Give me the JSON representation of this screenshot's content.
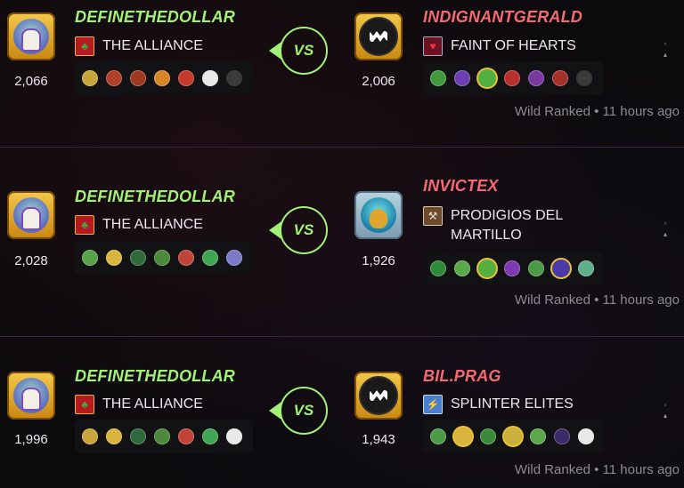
{
  "battles": [
    {
      "player": {
        "name": "DEFINETHEDOLLAR",
        "rating": "2,066",
        "guild": "THE ALLIANCE",
        "avatar": "wizard-avatar-icon"
      },
      "opponent": {
        "name": "INDIGNANTGERALD",
        "rating": "2,006",
        "guild": "FAINT OF HEARTS",
        "avatar": "monster-avatar-icon"
      },
      "vs_label": "VS",
      "format": "Wild Ranked",
      "time": "11 hours ago",
      "player_team": [
        "#c9a43a",
        "#b0402b",
        "#9c3a1f",
        "#d88428",
        "#c6382a",
        "#e8e8ea",
        "#3a3a3a"
      ],
      "opponent_team": [
        "#3f9a3c",
        "#6b3fb0",
        "#4fb040",
        "#b8302c",
        "#7a3aa0",
        "#a5302a",
        "#3a3a3a"
      ]
    },
    {
      "player": {
        "name": "DEFINETHEDOLLAR",
        "rating": "2,028",
        "guild": "THE ALLIANCE",
        "avatar": "wizard-avatar-icon"
      },
      "opponent": {
        "name": "INVICTEX",
        "rating": "1,926",
        "guild": "PRODIGIOS DEL MARTILLO",
        "avatar": "dragon-avatar-icon"
      },
      "vs_label": "VS",
      "format": "Wild Ranked",
      "time": "11 hours ago",
      "player_team": [
        "#58a24a",
        "#d9b43e",
        "#2e6a3a",
        "#4a8a3a",
        "#c24438",
        "#3fa552",
        "#7a7ac8"
      ],
      "opponent_team": [
        "#2f8a3a",
        "#5aa84a",
        "#56b040",
        "#7e3ab0",
        "#4c9a48",
        "#4a3aa8",
        "#5fb08a"
      ]
    },
    {
      "player": {
        "name": "DEFINETHEDOLLAR",
        "rating": "1,996",
        "guild": "THE ALLIANCE",
        "avatar": "wizard-avatar-icon"
      },
      "opponent": {
        "name": "BIL.PRAG",
        "rating": "1,943",
        "guild": "SPLINTER ELITES",
        "avatar": "monster-avatar-icon"
      },
      "vs_label": "VS",
      "format": "Wild Ranked",
      "time": "11 hours ago",
      "player_team": [
        "#c9a43a",
        "#d9b43e",
        "#2e6a3a",
        "#4a8a3a",
        "#c24438",
        "#3fa552",
        "#e8e8ea"
      ],
      "opponent_team": [
        "#4c9a48",
        "#d9b43e",
        "#3a8a3a",
        "#c9b03a",
        "#5aa84a",
        "#3a2a6a",
        "#e8e8ea"
      ]
    }
  ],
  "meta_separator": "•"
}
